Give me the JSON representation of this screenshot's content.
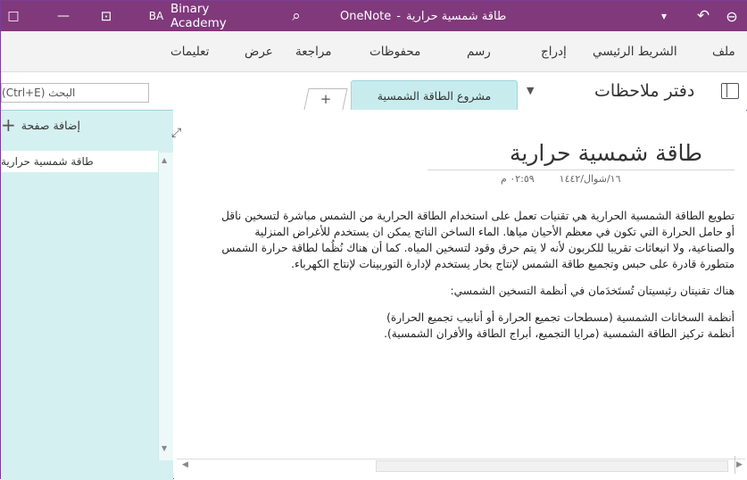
{
  "titlebar": {
    "initials": "BA",
    "account_name": "Binary Academy",
    "app_name": "OneNote",
    "separator": "-",
    "doc_title": "طاقة شمسية حرارية",
    "minimize_icon": "—",
    "restore_icon": "⊡",
    "search_icon": "⌕",
    "undo_icon": "↶",
    "back_icon": "⊖",
    "dropdown_icon": "▾",
    "window_icon": "□"
  },
  "ribbon": {
    "tabs": [
      "ملف",
      "الشريط الرئيسي",
      "إدراج",
      "رسم",
      "محفوظات",
      "مراجعة",
      "عرض",
      "تعليمات"
    ]
  },
  "notebook": {
    "name": "دفتر ملاحظات",
    "section_tab": "مشروع الطاقة الشمسية",
    "add_tab": "+",
    "search_placeholder": "البحث (Ctrl+E)"
  },
  "pages": {
    "add_page_label": "إضافة صفحة",
    "items": [
      "طاقة شمسية حرارية"
    ]
  },
  "page": {
    "title": "طاقة شمسية حرارية",
    "date": "١٦/شوال/١٤٤٢",
    "time": "٠٢:٥٩ م",
    "paragraph1": "تطويع الطاقة الشمسية الحرارية هي تقنيات تعمل على استخدام الطاقة الحرارية من الشمس مباشرة لتسخين ناقل أو حامل الحرارة التي تكون في معظم الأحيان مياها. الماء الساخن الناتج يمكن ان يستخدم للأغراض المنزلية والصناعية، ولا انبعاثات تقريبا للكربون لأنه لا يتم حرق وقود لتسخين المياه. كما أن هناك نُظُما لطاقة حرارة الشمس متطورة قادرة على حبس وتجميع طاقة الشمس لإنتاج بخار يستخدم لإدارة التوربينات لإنتاج الكهرباء.",
    "paragraph2": "هناك تقنيتان رئيسيتان تُستَخدَمان في أنظمة التسخين الشمسي:",
    "list": [
      "أنظمة السخانات الشمسية (مسطحات تجميع الحرارة أو أنابيب تجميع الحرارة)",
      "أنظمة تركيز الطاقة الشمسية (مرايا التجميع، أبراج الطاقة والأفران الشمسية)."
    ]
  },
  "colors": {
    "titlebar": "#80397b",
    "section_tab": "#c8ecee",
    "page_panel": "#d5f0f1"
  }
}
